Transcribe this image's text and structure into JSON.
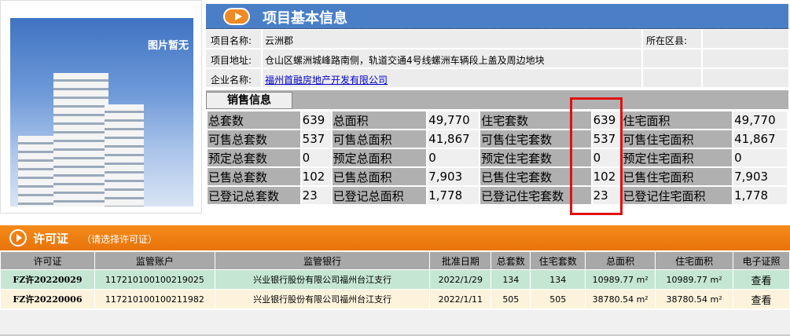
{
  "image": {
    "no_picture": "图片暂无"
  },
  "header": {
    "title": "项目基本信息"
  },
  "info": {
    "name_label": "项目名称:",
    "name": "云洲郡",
    "district_label": "所在区县:",
    "district": "",
    "address_label": "项目地址:",
    "address": "仓山区螺洲城峰路南侧，轨道交通4号线螺洲车辆段上盖及周边地块",
    "company_label": "企业名称:",
    "company": "福州首融房地产开发有限公司"
  },
  "sales": {
    "tab": "销售信息",
    "rows": [
      [
        "总套数",
        "639",
        "总面积",
        "49,770",
        "住宅套数",
        "639",
        "住宅面积",
        "49,770"
      ],
      [
        "可售总套数",
        "537",
        "可售总面积",
        "41,867",
        "可售住宅套数",
        "537",
        "可售住宅面积",
        "41,867"
      ],
      [
        "预定总套数",
        "0",
        "预定总面积",
        "0",
        "预定住宅套数",
        "0",
        "预定住宅面积",
        "0"
      ],
      [
        "已售总套数",
        "102",
        "已售总面积",
        "7,903",
        "已售住宅套数",
        "102",
        "已售住宅面积",
        "7,903"
      ],
      [
        "已登记总套数",
        "23",
        "已登记总面积",
        "1,778",
        "已登记住宅套数",
        "23",
        "已登记住宅面积",
        "1,778"
      ]
    ]
  },
  "permits": {
    "title": "许可证",
    "subtitle": "（请选择许可证）",
    "columns": [
      "许可证",
      "监管账户",
      "监管银行",
      "批准日期",
      "总套数",
      "住宅套数",
      "总面积",
      "住宅面积",
      "电子证照"
    ],
    "rows": [
      [
        "FZ许20220029",
        "117210100100219025",
        "兴业银行股份有限公司福州台江支行",
        "2022/1/29",
        "134",
        "134",
        "10989.77 m²",
        "10989.77 m²",
        "查看"
      ],
      [
        "FZ许20220006",
        "117210100100211982",
        "兴业银行股份有限公司福州台江支行",
        "2022/1/11",
        "505",
        "505",
        "38780.54 m²",
        "38780.54 m²",
        "查看"
      ]
    ]
  }
}
